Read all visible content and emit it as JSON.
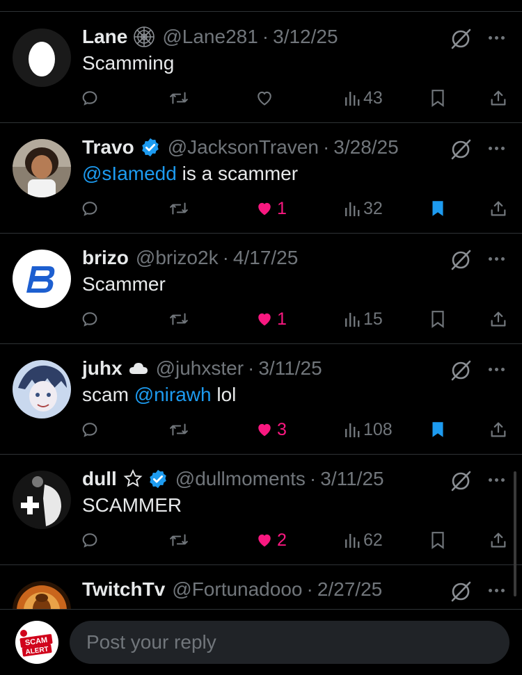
{
  "posts": [
    {
      "name": "Lane",
      "handle": "@Lane281",
      "date": "3/12/25",
      "text_parts": [
        {
          "t": "Scamming"
        }
      ],
      "likes": "",
      "liked": false,
      "views": "43",
      "bookmarked": false,
      "badge": "web-icon",
      "avatar": "egg"
    },
    {
      "name": "Travo",
      "handle": "@JacksonTraven",
      "date": "3/28/25",
      "text_parts": [
        {
          "t": "@sIamedd",
          "m": true
        },
        {
          "t": " is a scammer"
        }
      ],
      "likes": "1",
      "liked": true,
      "views": "32",
      "bookmarked": true,
      "badge": "verified-icon",
      "avatar": "photo"
    },
    {
      "name": "brizo",
      "handle": "@brizo2k",
      "date": "4/17/25",
      "text_parts": [
        {
          "t": "Scammer"
        }
      ],
      "likes": "1",
      "liked": true,
      "views": "15",
      "bookmarked": false,
      "badge": "",
      "avatar": "brizo-logo"
    },
    {
      "name": "juhx",
      "handle": "@juhxster",
      "date": "3/11/25",
      "text_parts": [
        {
          "t": "scam "
        },
        {
          "t": "@nirawh",
          "m": true
        },
        {
          "t": " lol"
        }
      ],
      "likes": "3",
      "liked": true,
      "views": "108",
      "bookmarked": true,
      "badge": "cloud-icon",
      "avatar": "anime"
    },
    {
      "name": "dull",
      "handle": "@dullmoments",
      "date": "3/11/25",
      "text_parts": [
        {
          "t": "SCAMMER"
        }
      ],
      "likes": "2",
      "liked": true,
      "views": "62",
      "bookmarked": false,
      "badge": "star-verified",
      "avatar": "bw-art"
    },
    {
      "name": "TwitchTv",
      "handle": "@Fortunadooo",
      "date": "2/27/25",
      "text_parts": [],
      "likes": "",
      "liked": false,
      "views": "",
      "bookmarked": false,
      "badge": "",
      "avatar": "buddha"
    }
  ],
  "reply_bar": {
    "placeholder": "Post your reply",
    "avatar_text_1": "SCAM",
    "avatar_text_2": "ALERT"
  },
  "colors": {
    "accent": "#1d9bf0",
    "like": "#f91880",
    "muted": "#71767b"
  }
}
